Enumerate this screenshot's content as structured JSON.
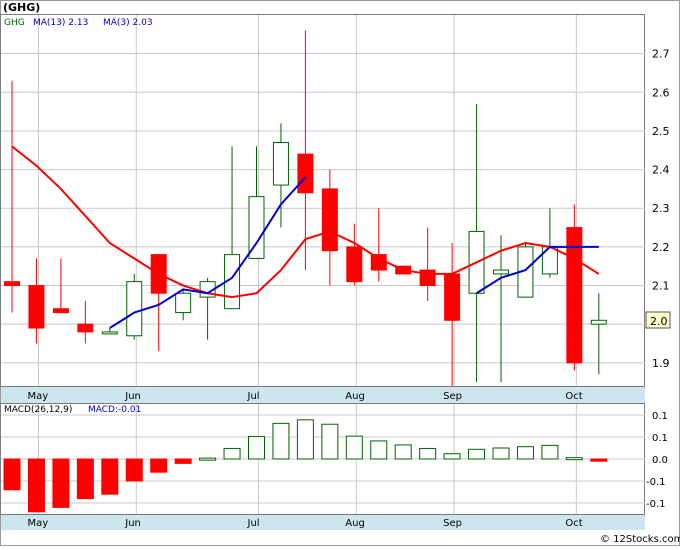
{
  "title": "(GHG)",
  "legend": {
    "symbol": "GHG",
    "ma13": "MA(13)  2.13",
    "ma3": "MA(3)  2.03"
  },
  "macd_legend": {
    "params": "MACD(26,12,9)",
    "value": "MACD:-0.01"
  },
  "last_price_label": "2.0",
  "watermark": "© 12Stocks.com",
  "colors": {
    "up": "#006400",
    "down": "#ff0000",
    "ma13": "#ff0000",
    "ma3": "#0000cc",
    "axis_band": "#cde5ee",
    "grid": "#c8c8c8"
  },
  "chart_data": {
    "type": "candlestick",
    "x_tick_labels": [
      "May",
      "Jun",
      "Jul",
      "Aug",
      "Sep",
      "Oct"
    ],
    "price_axis": {
      "ylim": [
        1.84,
        2.8
      ],
      "ticks": [
        "1.9",
        "2.0",
        "2.1",
        "2.2",
        "2.3",
        "2.4",
        "2.5",
        "2.6",
        "2.7"
      ]
    },
    "candles": [
      {
        "o": 2.11,
        "h": 2.63,
        "l": 2.03,
        "c": 2.1
      },
      {
        "o": 2.1,
        "h": 2.17,
        "l": 1.95,
        "c": 1.99
      },
      {
        "o": 2.04,
        "h": 2.17,
        "l": 2.03,
        "c": 2.03
      },
      {
        "o": 2.0,
        "h": 2.06,
        "l": 1.95,
        "c": 1.98
      },
      {
        "o": 1.98,
        "h": 1.99,
        "l": 1.98,
        "c": 1.98
      },
      {
        "o": 1.97,
        "h": 2.13,
        "l": 1.96,
        "c": 2.11
      },
      {
        "o": 2.18,
        "h": 2.18,
        "l": 1.93,
        "c": 2.08
      },
      {
        "o": 2.03,
        "h": 2.09,
        "l": 2.01,
        "c": 2.08
      },
      {
        "o": 2.07,
        "h": 2.12,
        "l": 1.96,
        "c": 2.11
      },
      {
        "o": 2.04,
        "h": 2.46,
        "l": 2.04,
        "c": 2.18
      },
      {
        "o": 2.17,
        "h": 2.46,
        "l": 2.17,
        "c": 2.33
      },
      {
        "o": 2.36,
        "h": 2.52,
        "l": 2.25,
        "c": 2.47
      },
      {
        "o": 2.44,
        "h": 2.76,
        "l": 2.14,
        "c": 2.34
      },
      {
        "o": 2.35,
        "h": 2.4,
        "l": 2.1,
        "c": 2.19
      },
      {
        "o": 2.2,
        "h": 2.26,
        "l": 2.1,
        "c": 2.11
      },
      {
        "o": 2.18,
        "h": 2.3,
        "l": 2.11,
        "c": 2.14
      },
      {
        "o": 2.15,
        "h": 2.15,
        "l": 2.13,
        "c": 2.13
      },
      {
        "o": 2.14,
        "h": 2.25,
        "l": 2.06,
        "c": 2.1
      },
      {
        "o": 2.13,
        "h": 2.21,
        "l": 1.84,
        "c": 2.01
      },
      {
        "o": 2.08,
        "h": 2.57,
        "l": 1.85,
        "c": 2.24
      },
      {
        "o": 2.13,
        "h": 2.23,
        "l": 1.85,
        "c": 2.14
      },
      {
        "o": 2.07,
        "h": 2.21,
        "l": 2.07,
        "c": 2.2
      },
      {
        "o": 2.13,
        "h": 2.3,
        "l": 2.12,
        "c": 2.2
      },
      {
        "o": 2.25,
        "h": 2.31,
        "l": 1.88,
        "c": 1.9
      },
      {
        "o": 2.0,
        "h": 2.08,
        "l": 1.87,
        "c": 2.01
      }
    ],
    "ma13": [
      2.46,
      2.41,
      2.35,
      2.28,
      2.21,
      2.17,
      2.13,
      2.1,
      2.08,
      2.07,
      2.08,
      2.14,
      2.22,
      2.24,
      2.21,
      2.17,
      2.14,
      2.13,
      2.13,
      2.16,
      2.19,
      2.21,
      2.2,
      2.17,
      2.13
    ],
    "ma3": [
      null,
      null,
      null,
      null,
      1.99,
      2.03,
      2.05,
      2.09,
      2.08,
      2.12,
      2.21,
      2.31,
      2.38,
      null,
      null,
      null,
      null,
      null,
      null,
      2.08,
      2.12,
      2.14,
      2.2,
      2.2,
      2.2
    ],
    "macd_axis": {
      "ylim": [
        -0.125,
        0.125
      ],
      "ticks": [
        "-0.1",
        "-0.1",
        "0.0",
        "0.1",
        "0.1"
      ]
    },
    "macd": [
      -0.07,
      -0.12,
      -0.11,
      -0.09,
      -0.08,
      -0.05,
      -0.03,
      -0.01,
      0.002,
      0.024,
      0.051,
      0.081,
      0.089,
      0.079,
      0.052,
      0.041,
      0.032,
      0.024,
      0.012,
      0.022,
      0.025,
      0.028,
      0.031,
      0.003,
      -0.005
    ]
  }
}
